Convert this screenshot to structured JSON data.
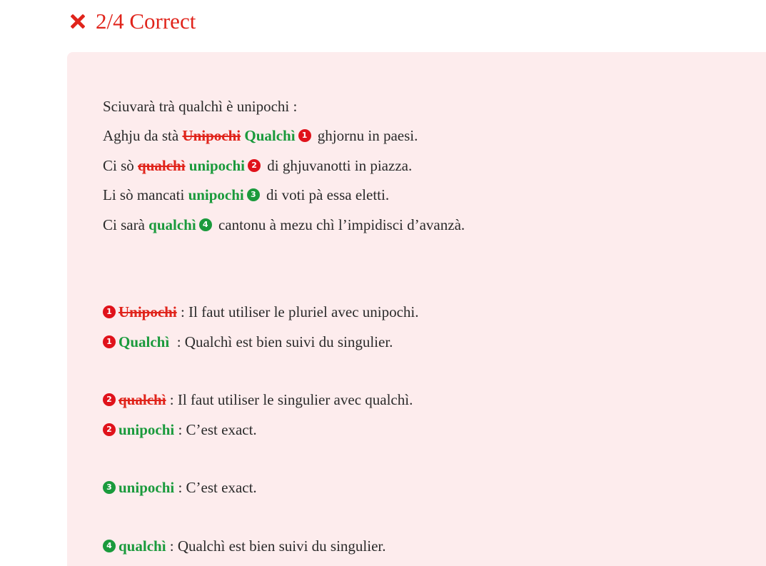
{
  "header": {
    "score": "2/4 Correct",
    "status_color": "#e0241b",
    "icon": "close-icon"
  },
  "exercise": {
    "instruction": "Sciuvarà trà qualchì è unipochi :",
    "sentences": [
      {
        "before": "Aghju da stà ",
        "wrong": "Unipochi",
        "correct": "Qualchì",
        "badge": "1",
        "after": " ghjornu in paesi."
      },
      {
        "before": "Ci sò ",
        "wrong": "qualchì",
        "correct": "unipochi",
        "badge": "2",
        "after": " di ghjuvanotti in piazza."
      },
      {
        "before": "Li sò mancati ",
        "correct": "unipochi",
        "badge": "3",
        "after": " di voti pà essa eletti."
      },
      {
        "before": "Ci sarà ",
        "correct": "qualchì",
        "badge": "4",
        "after": " cantonu à mezu chì l’impidisci d’avanzà."
      }
    ]
  },
  "feedback": [
    {
      "badge": "1",
      "word": "Unipochi",
      "text": " : Il faut utiliser le pluriel avec unipochi."
    },
    {
      "badge": "1",
      "word": "Qualchì",
      "text": "  : Qualchì est bien suivi du singulier."
    },
    {
      "badge": "2",
      "word": "qualchì",
      "text": " : Il faut utiliser le singulier avec qualchì."
    },
    {
      "badge": "2",
      "word": "unipochi",
      "text": " : C’est exact."
    },
    {
      "badge": "3",
      "word": "unipochi",
      "text": " : C’est exact."
    },
    {
      "badge": "4",
      "word": "qualchì",
      "text": " : Qualchì est bien suivi du singulier."
    }
  ],
  "colors": {
    "wrong": "#e0241b",
    "correct": "#1a9a3c",
    "panel_background": "#fdeced"
  }
}
